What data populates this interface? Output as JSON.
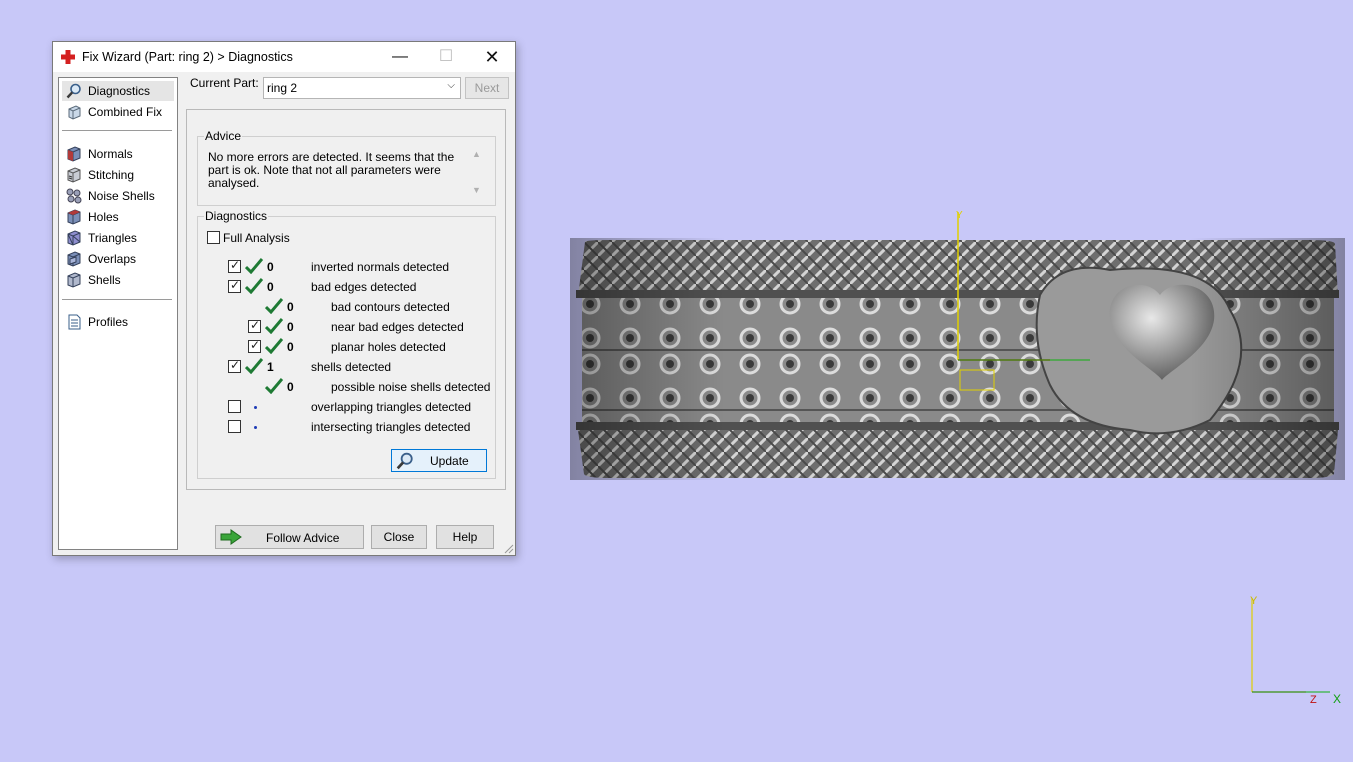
{
  "window": {
    "title": "Fix Wizard (Part: ring 2) > Diagnostics",
    "minimize_icon": "minimize-icon",
    "maximize_icon": "maximize-icon",
    "close_icon": "close-icon"
  },
  "nav": {
    "items": [
      {
        "label": "Diagnostics",
        "icon": "magnifier-icon"
      },
      {
        "label": "Combined Fix",
        "icon": "combined-fix-icon"
      },
      {
        "label": "Normals",
        "icon": "normals-icon"
      },
      {
        "label": "Stitching",
        "icon": "stitching-icon"
      },
      {
        "label": "Noise Shells",
        "icon": "noise-shells-icon"
      },
      {
        "label": "Holes",
        "icon": "holes-icon"
      },
      {
        "label": "Triangles",
        "icon": "triangles-icon"
      },
      {
        "label": "Overlaps",
        "icon": "overlaps-icon"
      },
      {
        "label": "Shells",
        "icon": "shells-icon"
      },
      {
        "label": "Profiles",
        "icon": "profiles-icon"
      }
    ]
  },
  "current_part": {
    "label": "Current Part:",
    "value": "ring 2",
    "next_label": "Next"
  },
  "advice": {
    "legend": "Advice",
    "text": "No more errors are detected. It seems that the part is ok. Note that not all parameters were analysed."
  },
  "diagnostics": {
    "legend": "Diagnostics",
    "full_analysis_label": "Full Analysis",
    "rows": [
      {
        "checked": true,
        "status": "ok",
        "value": "0",
        "label": "inverted normals detected"
      },
      {
        "checked": true,
        "status": "ok",
        "value": "0",
        "label": "bad edges detected"
      },
      {
        "checked": null,
        "status": "ok",
        "value": "0",
        "label": "bad contours detected"
      },
      {
        "checked": true,
        "status": "ok",
        "value": "0",
        "label": "near bad edges detected"
      },
      {
        "checked": true,
        "status": "ok",
        "value": "0",
        "label": "planar holes detected"
      },
      {
        "checked": true,
        "status": "ok",
        "value": "1",
        "label": "shells detected"
      },
      {
        "checked": null,
        "status": "ok",
        "value": "0",
        "label": "possible noise shells detected"
      },
      {
        "checked": false,
        "status": "none",
        "value": "",
        "label": "overlapping triangles detected"
      },
      {
        "checked": false,
        "status": "none",
        "value": "",
        "label": "intersecting triangles detected"
      }
    ],
    "update_label": "Update"
  },
  "buttons": {
    "follow_advice": "Follow Advice",
    "close": "Close",
    "help": "Help"
  },
  "viewport": {
    "axis_labels": {
      "y": "Y",
      "x": "X",
      "z": "Z"
    }
  },
  "colors": {
    "background": "#c8c8f8",
    "check_green": "#1e7a34",
    "axis_x": "#d01010",
    "axis_y": "#e0d000",
    "axis_z": "#10b010"
  }
}
